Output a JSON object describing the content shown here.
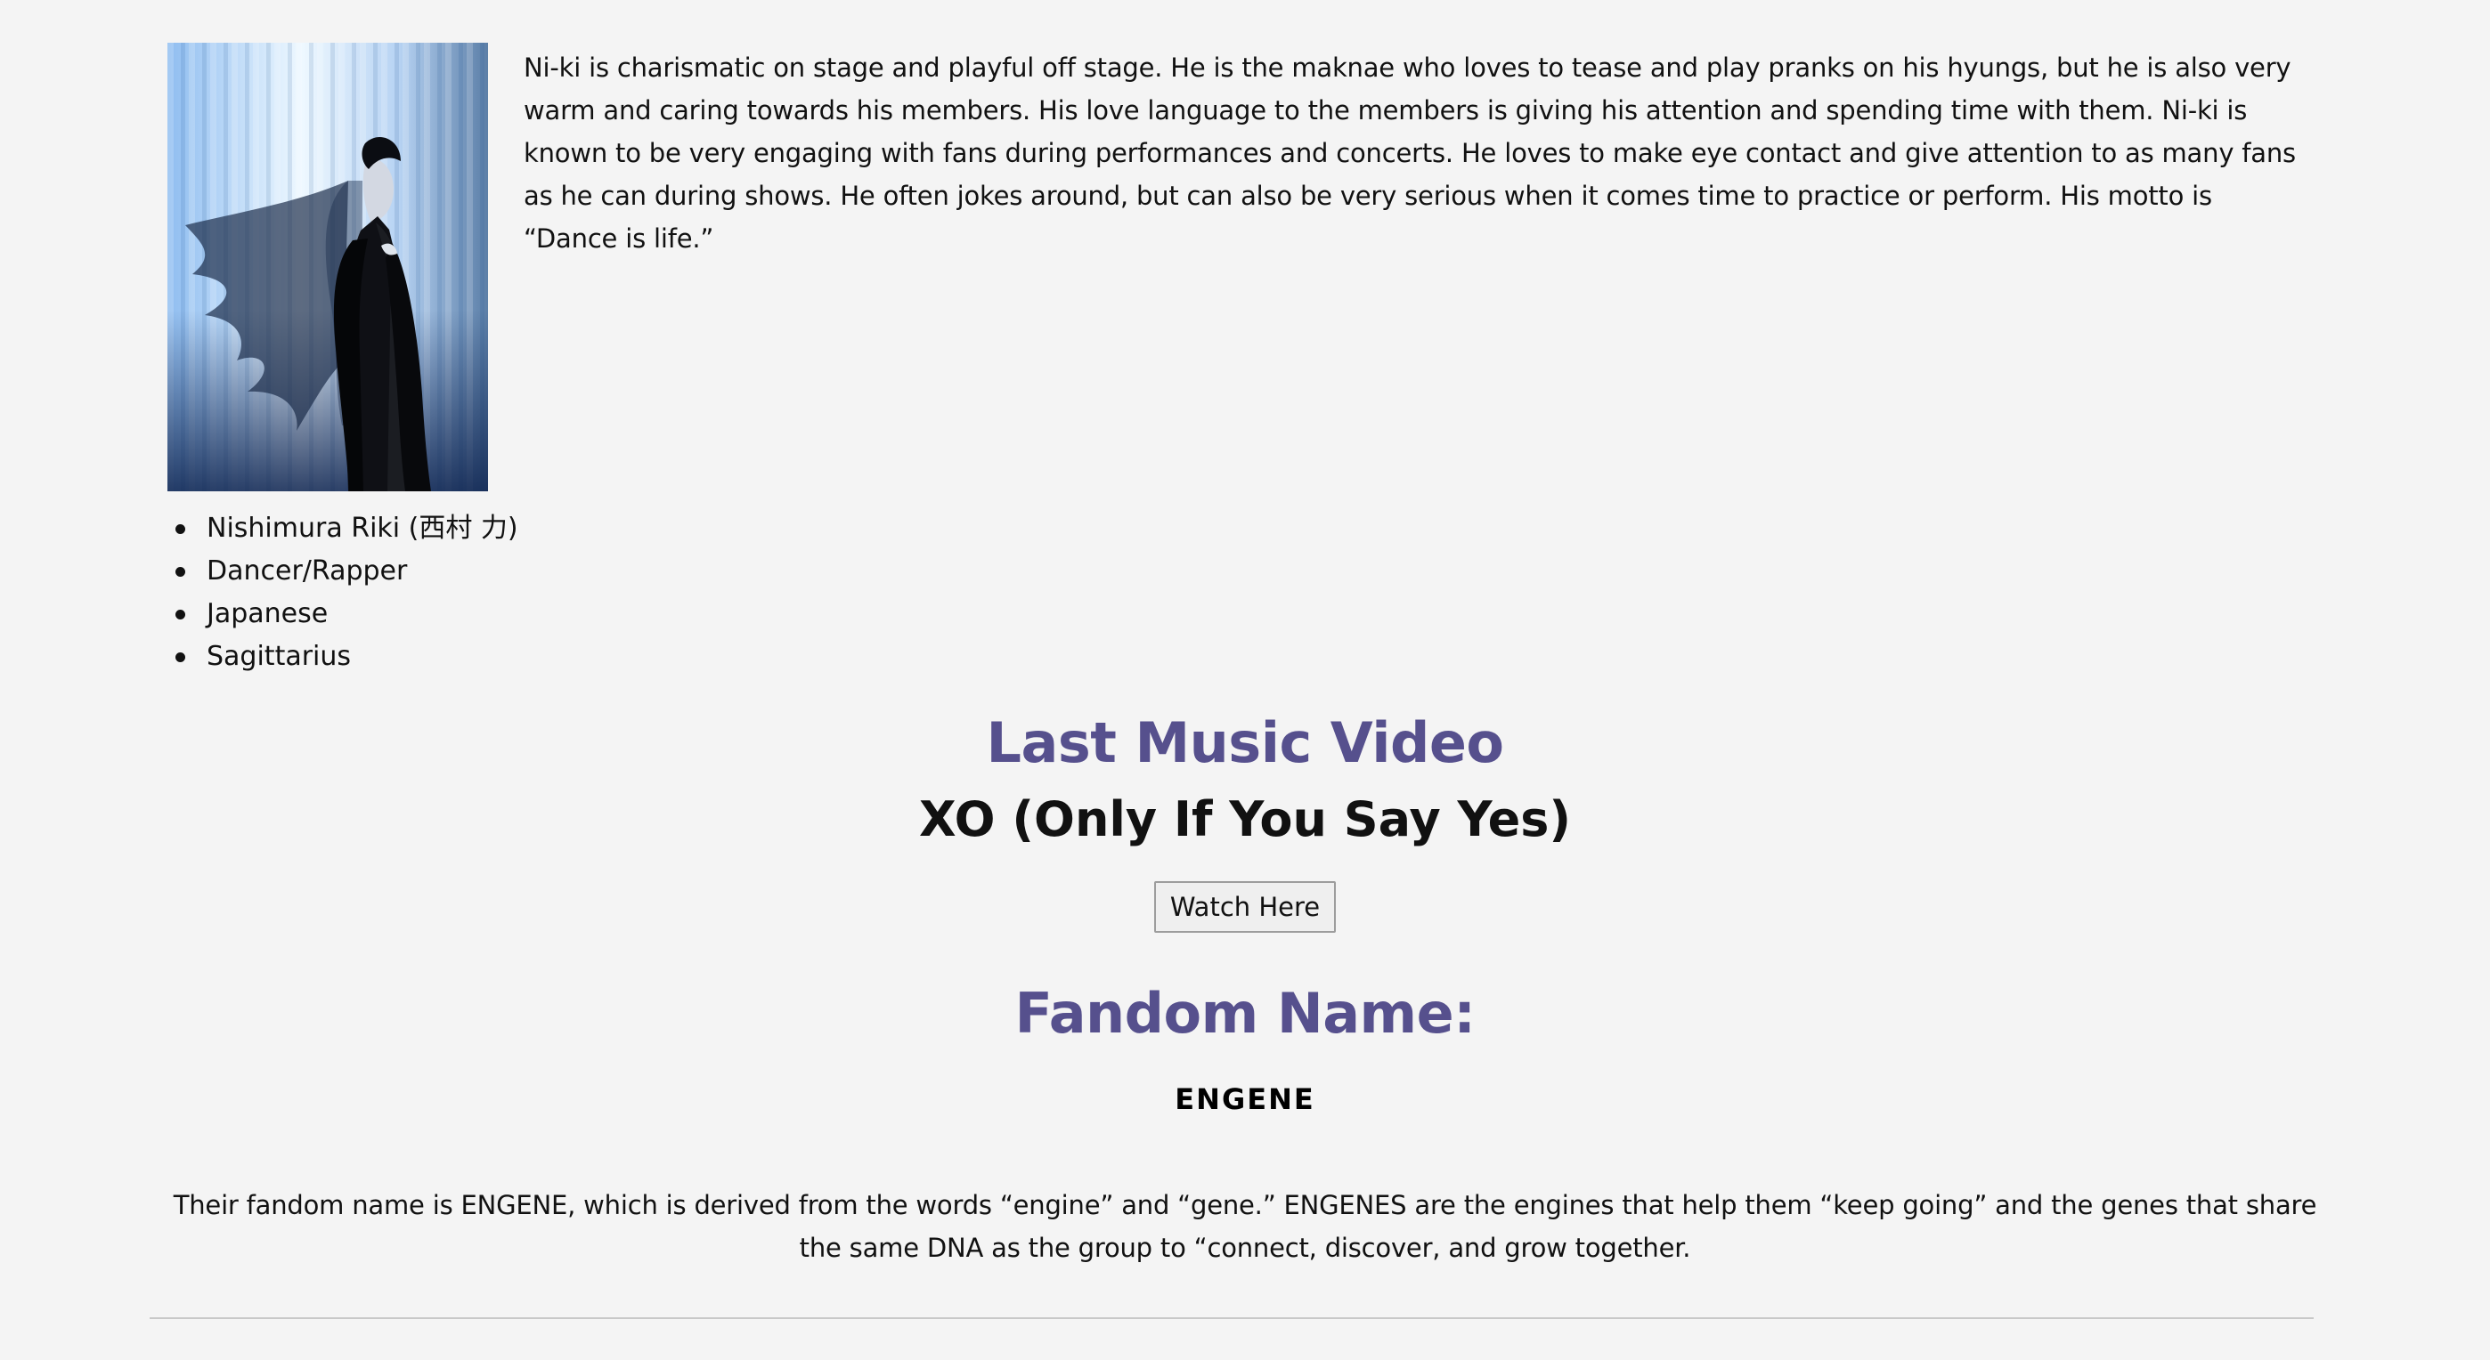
{
  "profile": {
    "photo_alt": "Ni-ki concept photo",
    "bio": "Ni-ki is charismatic on stage and playful off stage. He is the maknae who loves to tease and play pranks on his hyungs, but he is also very warm and caring towards his members. His love language to the members is giving his attention and spending time with them. Ni-ki is known to be very engaging with fans during performances and concerts. He loves to make eye contact and give attention to as many fans as he can during shows. He often jokes around, but can also be very serious when it comes time to practice or perform. His motto is “Dance is life.”",
    "facts": [
      "Nishimura Riki (西村 力)",
      "Dancer/Rapper",
      "Japanese",
      "Sagittarius"
    ]
  },
  "music_video": {
    "heading": "Last Music Video",
    "title": "XO (Only If You Say Yes)",
    "button_label": "Watch Here"
  },
  "fandom": {
    "heading": "Fandom Name:",
    "name": "ENGENE",
    "description": "Their fandom name is ENGENE, which is derived from the words “engine” and “gene.” ENGENES are the engines that help them “keep going” and the genes that share the same DNA as the group to “connect, discover, and grow together."
  },
  "colors": {
    "background": "#f4f4f4",
    "heading_accent": "#56508d",
    "text": "#111111"
  }
}
